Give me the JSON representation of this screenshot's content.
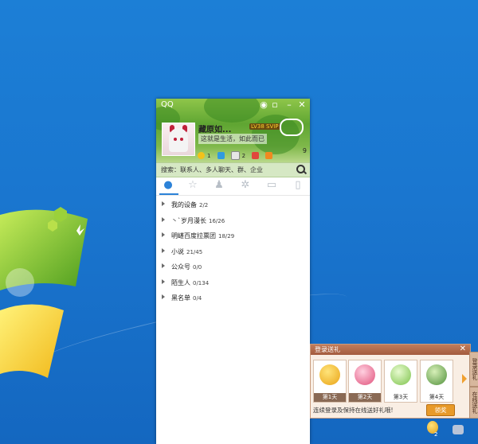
{
  "qq_window": {
    "app_title": "QQ",
    "nickname": "藏原如...",
    "level_badge": "LV38 SVIP",
    "signature": "这就是生活，如此而已",
    "status_counts": [
      "1",
      "2",
      "9"
    ],
    "search_placeholder": "搜索：联系人、多人聊天、群、企业",
    "tabs": [
      "contacts",
      "favorites",
      "groups",
      "apps",
      "messages",
      "phone"
    ],
    "groups": [
      {
        "name": "我的设备",
        "count": "2/2"
      },
      {
        "name": "丶`岁月漫长",
        "count": "16/26"
      },
      {
        "name": "⁡明嵁百度拉票团",
        "count": "18/29"
      },
      {
        "name": "小说",
        "count": "21/45"
      },
      {
        "name": "公众号",
        "count": "0/0"
      },
      {
        "name": "陌生人",
        "count": "0/134"
      },
      {
        "name": "黑名单",
        "count": "0/4"
      }
    ]
  },
  "login_gift": {
    "title": "登录送礼",
    "days": [
      "第1天",
      "第2天",
      "第3天",
      "第4天"
    ],
    "note": "连续登录及保持在线送好礼哦!",
    "claim_button": "领奖",
    "side_tabs": [
      "登录送礼",
      "在线送礼"
    ]
  },
  "tray": {
    "badge_count": "2"
  },
  "colors": {
    "desktop": "#1a76cf",
    "skin_green": "#5fa532",
    "tab_active": "#2c82d8",
    "gift_accent": "#e89a2a"
  }
}
